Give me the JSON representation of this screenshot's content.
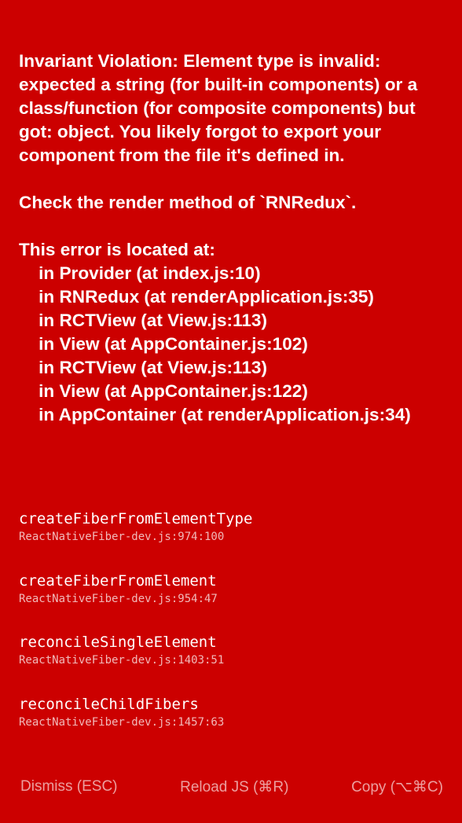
{
  "error": {
    "message": "Invariant Violation: Element type is invalid: expected a string (for built-in components) or a class/function (for composite components) but got: object. You likely forgot to export your component from the file it's defined in.\n\nCheck the render method of `RNRedux`.\n\nThis error is located at:\n    in Provider (at index.js:10)\n    in RNRedux (at renderApplication.js:35)\n    in RCTView (at View.js:113)\n    in View (at AppContainer.js:102)\n    in RCTView (at View.js:113)\n    in View (at AppContainer.js:122)\n    in AppContainer (at renderApplication.js:34)"
  },
  "stack": [
    {
      "function": "createFiberFromElementType",
      "location": "ReactNativeFiber-dev.js:974:100"
    },
    {
      "function": "createFiberFromElement",
      "location": "ReactNativeFiber-dev.js:954:47"
    },
    {
      "function": "reconcileSingleElement",
      "location": "ReactNativeFiber-dev.js:1403:51"
    },
    {
      "function": "reconcileChildFibers",
      "location": "ReactNativeFiber-dev.js:1457:63"
    }
  ],
  "footer": {
    "dismiss_label": "Dismiss (ESC)",
    "reload_label": "Reload JS (⌘R)",
    "copy_label": "Copy (⌥⌘C)"
  },
  "colors": {
    "background": "#cc0000",
    "text": "#ffffff"
  }
}
